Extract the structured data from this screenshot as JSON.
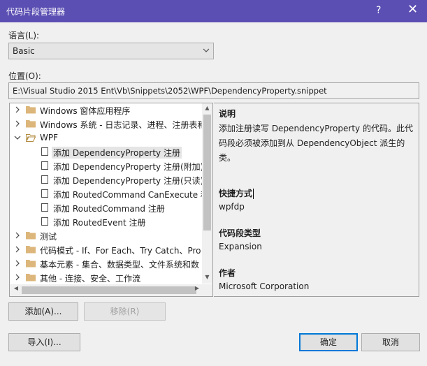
{
  "window": {
    "title": "代码片段管理器",
    "help_label": "?",
    "close_label": "✕"
  },
  "language": {
    "label": "语言(L):",
    "value": "Basic"
  },
  "location": {
    "label": "位置(O):",
    "value": "E:\\Visual Studio 2015 Ent\\Vb\\Snippets\\2052\\WPF\\DependencyProperty.snippet"
  },
  "tree": {
    "items": [
      {
        "label": "Windows 窗体应用程序",
        "kind": "folder",
        "expanded": false,
        "selected": false
      },
      {
        "label": "Windows 系统 - 日志记录、进程、注册表和",
        "kind": "folder",
        "expanded": false,
        "selected": false
      },
      {
        "label": "WPF",
        "kind": "folder",
        "expanded": true,
        "selected": false
      },
      {
        "label": "添加 DependencyProperty 注册",
        "kind": "snippet",
        "selected": true
      },
      {
        "label": "添加 DependencyProperty 注册(附加)",
        "kind": "snippet",
        "selected": false
      },
      {
        "label": "添加 DependencyProperty 注册(只读)",
        "kind": "snippet",
        "selected": false
      },
      {
        "label": "添加 RoutedCommand CanExecute 和",
        "kind": "snippet",
        "selected": false
      },
      {
        "label": "添加 RoutedCommand 注册",
        "kind": "snippet",
        "selected": false
      },
      {
        "label": "添加 RoutedEvent 注册",
        "kind": "snippet",
        "selected": false
      },
      {
        "label": "测试",
        "kind": "folder",
        "expanded": false,
        "selected": false
      },
      {
        "label": "代码模式 - If、For Each、Try Catch、Pro",
        "kind": "folder",
        "expanded": false,
        "selected": false
      },
      {
        "label": "基本元素 - 集合、数据类型、文件系统和数",
        "kind": "folder",
        "expanded": false,
        "selected": false
      },
      {
        "label": "其他 - 连接、安全、工作流",
        "kind": "folder",
        "expanded": false,
        "selected": false
      }
    ]
  },
  "details": {
    "description_heading": "说明",
    "description_text": "添加注册读写 DependencyProperty 的代码。此代码段必须被添加到从 DependencyObject 派生的类。",
    "shortcut_heading": "快捷方式",
    "shortcut_value": "wpfdp",
    "type_heading": "代码段类型",
    "type_value": "Expansion",
    "author_heading": "作者",
    "author_value": "Microsoft Corporation"
  },
  "buttons": {
    "add": "添加(A)...",
    "remove": "移除(R)",
    "import": "导入(I)...",
    "ok": "确定",
    "cancel": "取消"
  },
  "colors": {
    "titlebar": "#5b4fb3",
    "default_button_border": "#0078d7",
    "folder": "#dcb67a"
  }
}
